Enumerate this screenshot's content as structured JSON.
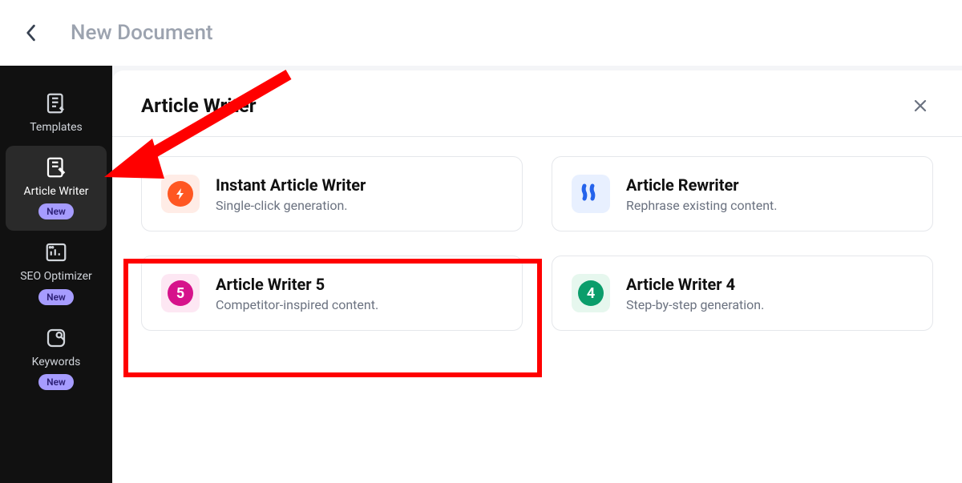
{
  "topbar": {
    "title": "New Document"
  },
  "sidebar": {
    "items": [
      {
        "label": "Templates",
        "new": false
      },
      {
        "label": "Article Writer",
        "new": true
      },
      {
        "label": "SEO Optimizer",
        "new": true
      },
      {
        "label": "Keywords",
        "new": true
      }
    ],
    "new_badge_label": "New"
  },
  "content": {
    "title": "Article Writer",
    "cards": [
      {
        "title": "Instant Article Writer",
        "desc": "Single-click generation."
      },
      {
        "title": "Article Rewriter",
        "desc": "Rephrase existing content."
      },
      {
        "title": "Article Writer 5",
        "desc": "Competitor-inspired content.",
        "badge": "5"
      },
      {
        "title": "Article Writer 4",
        "desc": "Step-by-step generation.",
        "badge": "4"
      }
    ]
  }
}
